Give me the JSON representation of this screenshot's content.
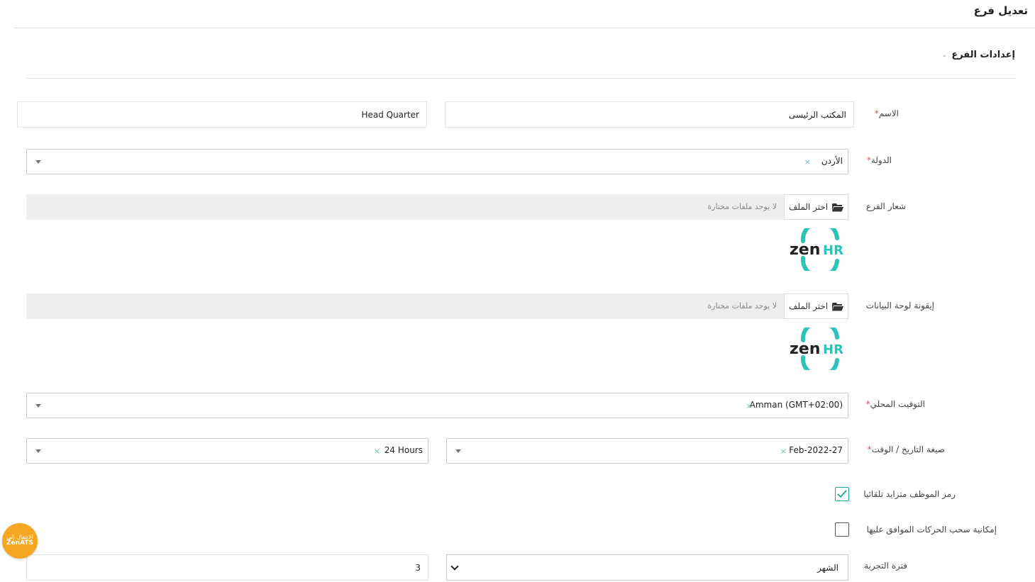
{
  "page_title": "تعديل فرع",
  "section": {
    "title": "إعدادات الفرع",
    "chevron_icon": "chevron-down-icon"
  },
  "fields": {
    "name": {
      "label": "الاسم",
      "required": "*",
      "value_ar": "المكتب الرئيسى",
      "value_en": "Head Quarter"
    },
    "country": {
      "label": "الدولة",
      "required": "*",
      "value": "الأردن",
      "clear": "×"
    },
    "branch_logo": {
      "label": "شعار الفرع",
      "button": "اختر الملف",
      "no_file": "لا يوجد ملفات مختارة",
      "logo_text": "zenHR"
    },
    "dashboard_icon": {
      "label": "إيقونة لوحة البيانات",
      "button": "اختر الملف",
      "no_file": "لا يوجد ملفات مختارة",
      "logo_text": "zenHR"
    },
    "timezone": {
      "label": "التوقيت المحلي",
      "required": "*",
      "value": "Amman (GMT+02:00)",
      "clear": "×"
    },
    "datetime_format": {
      "label": "صيغة التاريخ / الوقت",
      "required": "*",
      "date_value": "Feb-2022-27",
      "time_value": "24 Hours",
      "clear": "×"
    },
    "auto_increment": {
      "label": "رمز الموظف متزايد تلقائيا",
      "checked": true
    },
    "withdraw_approved": {
      "label": "إمكانية سحب الحركات الموافق عليها",
      "checked": false
    },
    "probation": {
      "label": "فترة التجربة",
      "unit": "الشهر",
      "value": "3"
    }
  },
  "badge": {
    "line1": "الانتقال إلى",
    "line2": "ZenATS"
  },
  "colors": {
    "accent": "#1aa79c",
    "brand_teal": "#2cc4b8",
    "badge": "#f5a623",
    "required": "#d9534f"
  }
}
